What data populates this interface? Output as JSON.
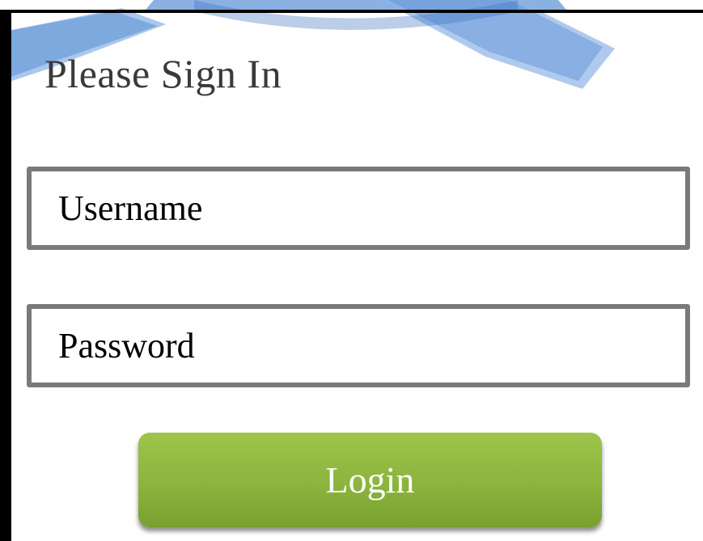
{
  "form": {
    "title": "Please Sign In",
    "username": {
      "placeholder": "Username",
      "value": ""
    },
    "password": {
      "placeholder": "Password",
      "value": ""
    },
    "login_label": "Login"
  },
  "colors": {
    "emblem_blue": "#5a8fd6",
    "button_green": "#8cb43e",
    "field_border": "#7a7a7a",
    "panel_border": "#000000"
  },
  "icons": {
    "emblem": "ribbon-banner-icon"
  }
}
